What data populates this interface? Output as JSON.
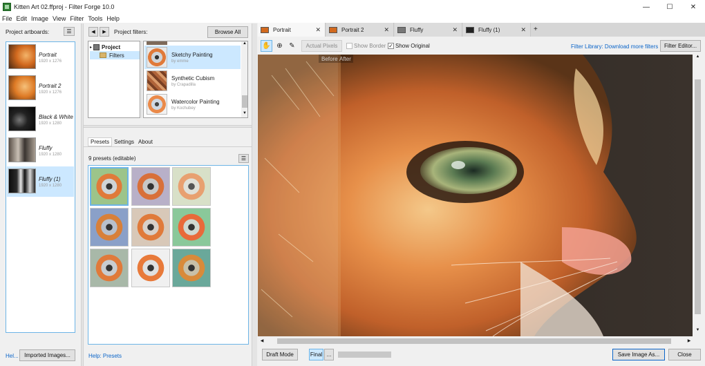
{
  "window": {
    "title": "Kitten Art 02.ffproj - Filter Forge 10.0",
    "minimize": "—",
    "maximize": "☐",
    "close": "✕"
  },
  "menu": [
    "File",
    "Edit",
    "Image",
    "View",
    "Filter",
    "Tools",
    "Help"
  ],
  "artboards": {
    "header": "Project artboards:",
    "items": [
      {
        "name": "Portrait",
        "size": "1920 x 1276"
      },
      {
        "name": "Portrait 2",
        "size": "1920 x 1276"
      },
      {
        "name": "Black & White",
        "size": "1920 x 1280"
      },
      {
        "name": "Fluffy",
        "size": "1920 x 1280"
      },
      {
        "name": "Fluffy (1)",
        "size": "1920 x 1280"
      }
    ],
    "help_link": "Hel...",
    "imported_button": "Imported Images..."
  },
  "filters": {
    "nav_back": "◀",
    "nav_forward": "▶",
    "header": "Project filters:",
    "browse_button": "Browse All",
    "tree": [
      {
        "label": "Project"
      },
      {
        "label": "Filters"
      }
    ],
    "items": [
      {
        "name": "Sketchy Painting",
        "author": "by emme"
      },
      {
        "name": "Synthetic Cubism",
        "author": "by Crapadilla"
      },
      {
        "name": "Watercolor Painting",
        "author": "by Kochubey"
      }
    ]
  },
  "presets": {
    "tabs": [
      "Presets",
      "Settings",
      "About"
    ],
    "count_label": "9 presets (editable)",
    "help_link": "Help: Presets"
  },
  "doc_tabs": [
    "Portrait",
    "Portrait 2",
    "Fluffy",
    "Fluffy (1)"
  ],
  "add_tab": "+",
  "toolbar": {
    "actual_pixels": "Actual Pixels",
    "show_border": "Show Border",
    "show_original": "Show Original",
    "library_link": "Filter Library: Download more filters",
    "filter_editor": "Filter Editor..."
  },
  "canvas": {
    "before": "Before",
    "after": "After"
  },
  "bottom": {
    "draft_mode": "Draft Mode",
    "final": "Final",
    "more": "...",
    "save_as": "Save Image As...",
    "close": "Close"
  },
  "colors": {
    "accent": "#6cb4e6",
    "link": "#0a64c8",
    "selection": "#cce8ff"
  }
}
